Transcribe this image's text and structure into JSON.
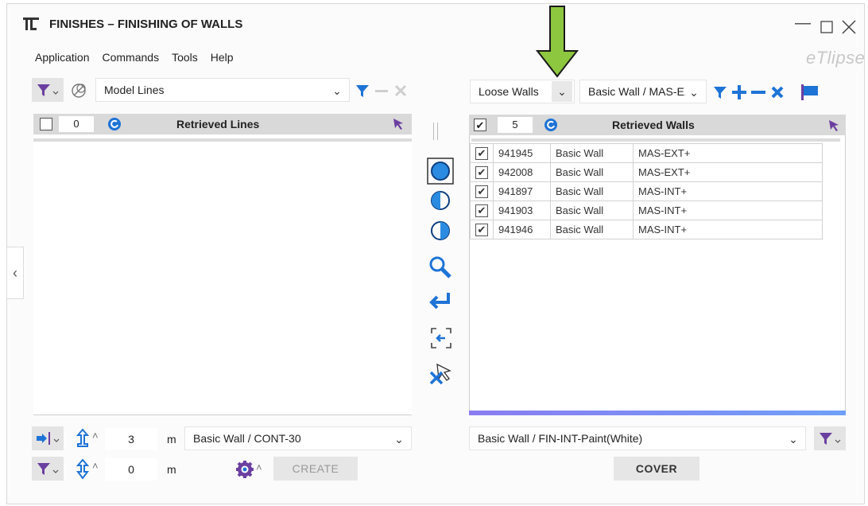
{
  "window": {
    "title": "FINISHES – FINISHING OF WALLS",
    "brand": "eTlipse"
  },
  "menu": [
    "Application",
    "Commands",
    "Tools",
    "Help"
  ],
  "left": {
    "source_combo": "Model Lines",
    "header": {
      "count": "0",
      "label": "Retrieved Lines"
    },
    "height_value": "3",
    "height_unit": "m",
    "offset_value": "0",
    "offset_unit": "m",
    "wall_type": "Basic Wall / CONT-30",
    "create_label": "CREATE"
  },
  "right": {
    "mode_combo": "Loose Walls",
    "type_combo": "Basic Wall / MAS-EXT",
    "header": {
      "count": "5",
      "label": "Retrieved Walls"
    },
    "rows": [
      {
        "id": "941945",
        "family": "Basic Wall",
        "type": "MAS-EXT+",
        "checked": true
      },
      {
        "id": "942008",
        "family": "Basic Wall",
        "type": "MAS-EXT+",
        "checked": true
      },
      {
        "id": "941897",
        "family": "Basic Wall",
        "type": "MAS-INT+",
        "checked": true
      },
      {
        "id": "941903",
        "family": "Basic Wall",
        "type": "MAS-INT+",
        "checked": true
      },
      {
        "id": "941946",
        "family": "Basic Wall",
        "type": "MAS-INT+",
        "checked": true
      }
    ],
    "finish_type": "Basic Wall / FIN-INT-Paint(White)",
    "cover_label": "COVER"
  },
  "colors": {
    "accent_blue": "#1e73d6",
    "filter_purple": "#6b3fa0",
    "arrow_green": "#8dc63f",
    "progress": "#8a7cf0"
  }
}
